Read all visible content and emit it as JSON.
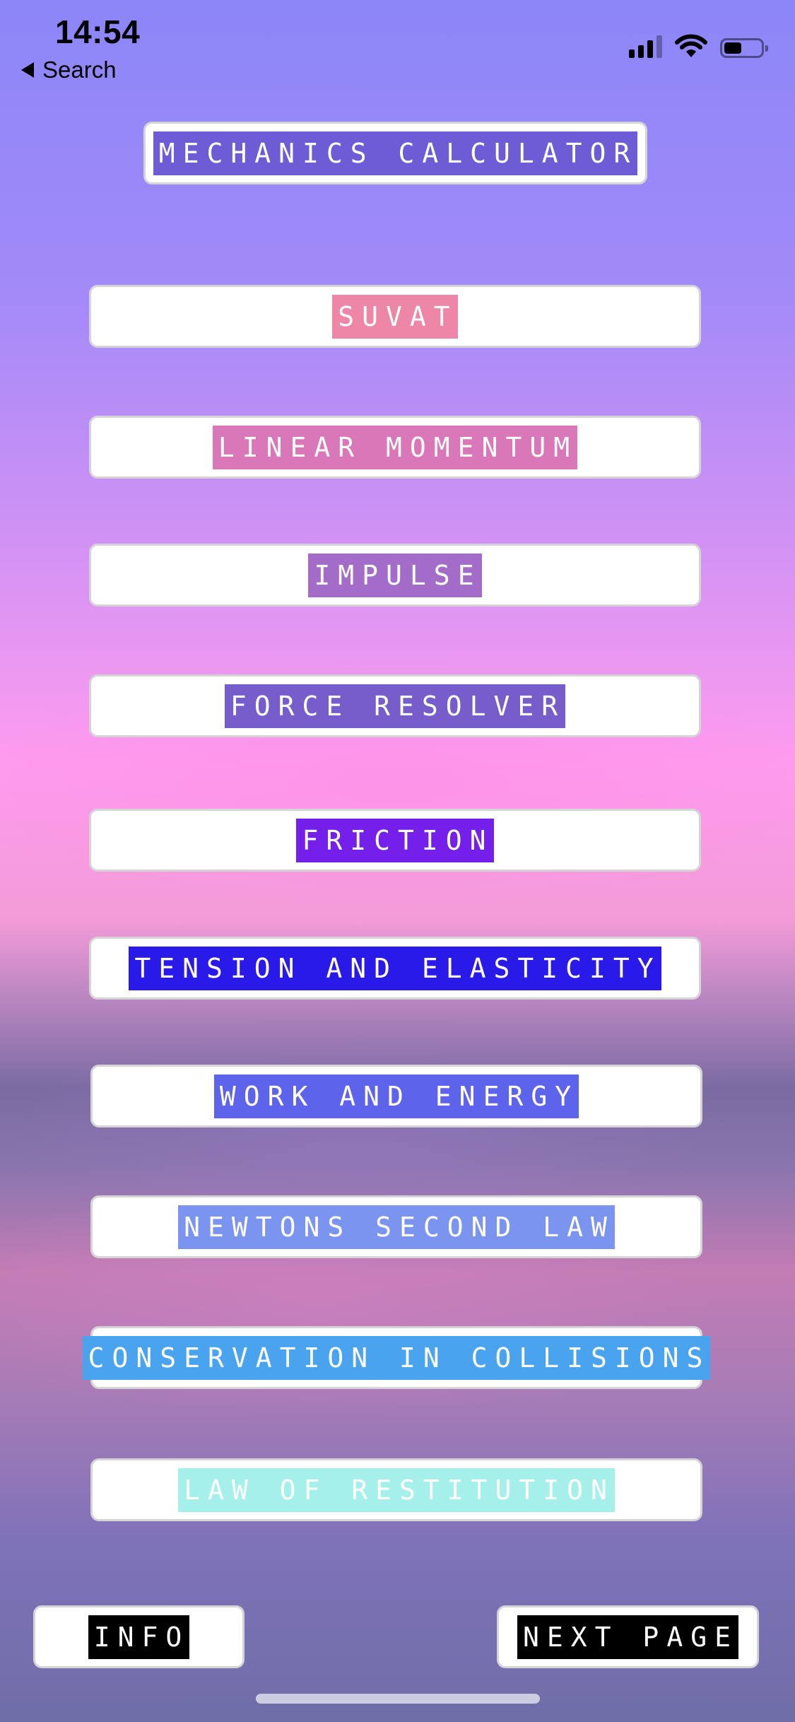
{
  "status_bar": {
    "time": "14:54",
    "back_label": "Search",
    "icons": [
      "cellular-signal-icon",
      "wifi-icon",
      "battery-icon"
    ]
  },
  "title": {
    "label": "MECHANICS CALCULATOR",
    "label_bg": "#6e5cd6"
  },
  "menu": [
    {
      "label": "SUVAT",
      "label_bg": "#ee86a8"
    },
    {
      "label": "LINEAR MOMENTUM",
      "label_bg": "#d977b8"
    },
    {
      "label": "IMPULSE",
      "label_bg": "#a36cc9"
    },
    {
      "label": "FORCE RESOLVER",
      "label_bg": "#775dcc"
    },
    {
      "label": "FRICTION",
      "label_bg": "#7420ea"
    },
    {
      "label": "TENSION AND ELASTICITY",
      "label_bg": "#2a1aea"
    },
    {
      "label": "WORK AND ENERGY",
      "label_bg": "#5e63ec"
    },
    {
      "label": "NEWTONS SECOND LAW",
      "label_bg": "#7b94ef"
    },
    {
      "label": "CONSERVATION IN COLLISIONS",
      "label_bg": "#4aa3ef"
    },
    {
      "label": "LAW OF RESTITUTION",
      "label_bg": "#a6f0ec"
    }
  ],
  "footer": {
    "info_label": "INFO",
    "next_label": "NEXT PAGE",
    "footer_label_bg": "#000000"
  }
}
